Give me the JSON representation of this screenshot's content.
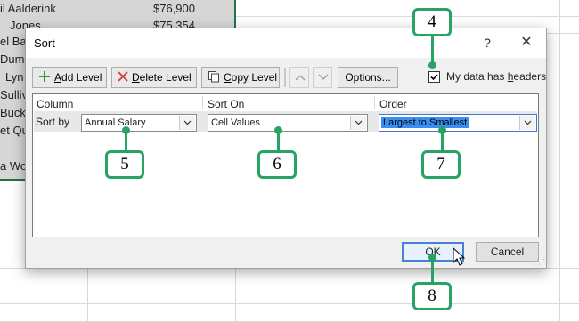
{
  "spreadsheet": {
    "rows": [
      {
        "name": "il Aalderink",
        "salary": "$76,900"
      },
      {
        "name": "Jones",
        "salary": "$75,354"
      },
      {
        "name": "el Ba",
        "salary": ""
      },
      {
        "name": "Duma",
        "salary": ""
      },
      {
        "name": "Lyn",
        "salary": ""
      },
      {
        "name": "Sulliv",
        "salary": ""
      },
      {
        "name": "Buck",
        "salary": ""
      },
      {
        "name": "et Qu",
        "salary": ""
      },
      {
        "name": "a Wo",
        "salary": ""
      }
    ]
  },
  "dialog": {
    "title": "Sort",
    "help_label": "?",
    "close_label": "✕",
    "toolbar": {
      "add_level": {
        "mnemonic": "A",
        "rest": "dd Level"
      },
      "delete_level": {
        "mnemonic": "D",
        "rest": "elete Level"
      },
      "copy_level": {
        "mnemonic": "C",
        "rest": "opy Level"
      },
      "options": "Options..."
    },
    "headers_checkbox": {
      "label_pre": "My data has ",
      "label_mn": "h",
      "label_post": "eaders",
      "checked": true
    },
    "columns": {
      "column": "Column",
      "sort_on": "Sort On",
      "order": "Order"
    },
    "level": {
      "label": "Sort by",
      "column_value": "Annual Salary",
      "sort_on_value": "Cell Values",
      "order_value": "Largest to Smallest"
    },
    "ok_label": "OK",
    "cancel_label": "Cancel"
  },
  "callouts": [
    "4",
    "5",
    "6",
    "7",
    "8"
  ],
  "colors": {
    "accent": "#27a363",
    "selection": "#3a8ff0",
    "excel_green": "#217346"
  }
}
